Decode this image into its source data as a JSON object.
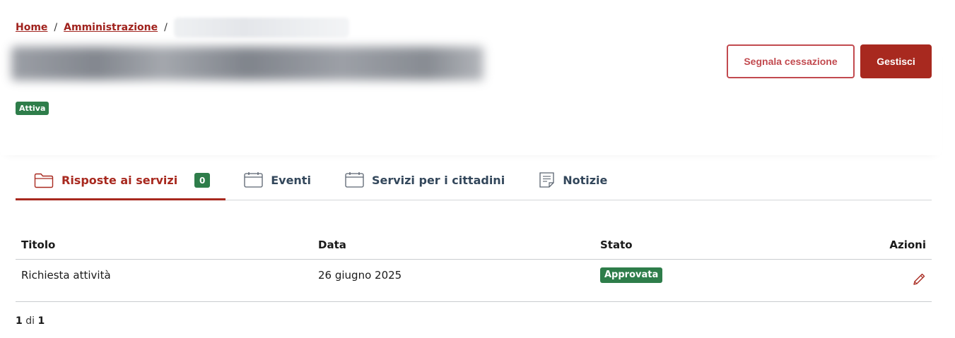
{
  "breadcrumb": {
    "home": "Home",
    "admin": "Amministrazione",
    "separator": "/"
  },
  "header": {
    "report_button": "Segnala cessazione",
    "manage_button": "Gestisci",
    "status_badge": "Attiva"
  },
  "tabs": [
    {
      "label": "Risposte ai servizi",
      "icon": "folder-icon",
      "count": "0",
      "active": true
    },
    {
      "label": "Eventi",
      "icon": "calendar-icon"
    },
    {
      "label": "Servizi per i cittadini",
      "icon": "calendar-icon"
    },
    {
      "label": "Notizie",
      "icon": "note-icon"
    }
  ],
  "table": {
    "headers": {
      "title": "Titolo",
      "date": "Data",
      "status": "Stato",
      "actions": "Azioni"
    },
    "rows": [
      {
        "title": "Richiesta attività",
        "date": "26 giugno 2025",
        "status": "Approvata",
        "action_icon": "pencil-icon"
      }
    ]
  },
  "pagination": {
    "current": "1",
    "of": "di",
    "total": "1"
  },
  "colors": {
    "accent": "#a8291f",
    "outline": "#c24a4f",
    "success": "#2e7d4a",
    "tab_text": "#33475b"
  }
}
